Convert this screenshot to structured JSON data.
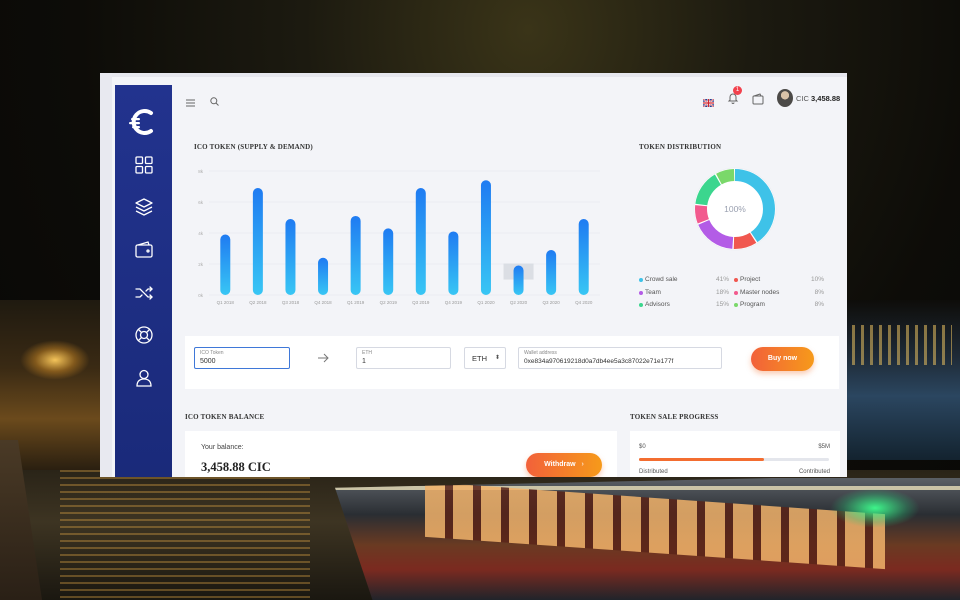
{
  "colors": {
    "sidebar": "#22338e",
    "bar_top": "#1f7bf2",
    "bar_bottom": "#38c6f4",
    "accent_orange": "#f36d30",
    "badge": "#f2424e"
  },
  "sidebar": {
    "logo": "C",
    "items": [
      {
        "icon": "dashboard-grid-icon"
      },
      {
        "icon": "layers-icon"
      },
      {
        "icon": "wallet-icon"
      },
      {
        "icon": "shuffle-icon"
      },
      {
        "icon": "support-lifebuoy-icon"
      },
      {
        "icon": "user-icon"
      }
    ]
  },
  "topbar": {
    "notifications_count": "1",
    "balance_prefix": "CIC",
    "balance_value": "3,458.88",
    "icons": [
      "menu-icon",
      "search-icon",
      "uk-flag-icon",
      "bell-icon",
      "wallet-icon",
      "avatar"
    ]
  },
  "supply_chart": {
    "title": "ICO TOKEN (SUPPLY & DEMAND)"
  },
  "chart_data": {
    "type": "bar",
    "title": "ICO TOKEN (SUPPLY & DEMAND)",
    "categories": [
      "Q1 2018",
      "Q2 2018",
      "Q3 2018",
      "Q4 2018",
      "Q1 2019",
      "Q2 2019",
      "Q3 2019",
      "Q4 2019",
      "Q1 2020",
      "Q2 2020",
      "Q3 2020",
      "Q4 2020"
    ],
    "values": [
      3.9,
      6.9,
      4.9,
      2.4,
      5.1,
      4.3,
      6.9,
      4.1,
      7.4,
      1.9,
      2.9,
      4.9
    ],
    "ytick_labels": [
      "0k",
      "2k",
      "4k",
      "6k",
      "8k"
    ],
    "ylim": [
      0,
      8
    ],
    "grid": true,
    "highlight_category": "Q2 2020"
  },
  "distribution": {
    "title": "TOKEN DISTRIBUTION",
    "center_label": "100%",
    "segments": [
      {
        "name": "Crowd sale",
        "pct": "41%",
        "value": 41,
        "color": "#3ec2e8"
      },
      {
        "name": "Project",
        "pct": "10%",
        "value": 10,
        "color": "#f0574f"
      },
      {
        "name": "Team",
        "pct": "18%",
        "value": 18,
        "color": "#b35ce6"
      },
      {
        "name": "Master nodes",
        "pct": "8%",
        "value": 8,
        "color": "#f25a8e"
      },
      {
        "name": "Advisors",
        "pct": "15%",
        "value": 15,
        "color": "#3bd68e"
      },
      {
        "name": "Program",
        "pct": "8%",
        "value": 8,
        "color": "#7ad86a"
      }
    ]
  },
  "buy": {
    "ico_label": "ICO Token",
    "ico_value": "5000",
    "eth_label": "ETH",
    "eth_value": "1",
    "currency": "ETH",
    "wallet_label": "Wallet address",
    "wallet_value": "0xe834a970619218d0a7db4ee5a3c87022e71e177f",
    "button": "Buy now"
  },
  "balance": {
    "title": "ICO TOKEN BALANCE",
    "label": "Your balance:",
    "value": "3,458.88 CIC",
    "button": "Withdraw"
  },
  "sale": {
    "title": "TOKEN SALE PROGRESS",
    "min": "$0",
    "max": "$5M",
    "progress": 0.66,
    "left_label": "Distributed",
    "right_label": "Contributed"
  }
}
